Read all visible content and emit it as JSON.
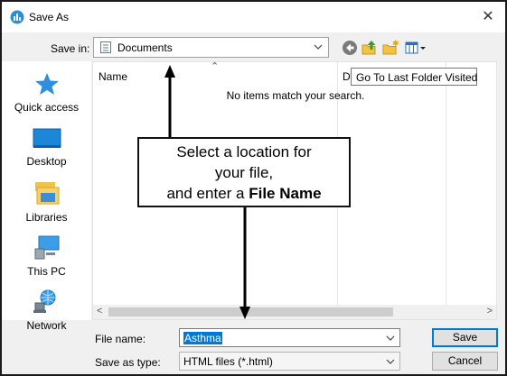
{
  "window": {
    "title": "Save As"
  },
  "toolbar": {
    "save_in_label": "Save in:",
    "save_in_value": "Documents",
    "tooltip": "Go To Last Folder Visited"
  },
  "places": [
    {
      "label": "Quick access",
      "icon": "star-icon"
    },
    {
      "label": "Desktop",
      "icon": "desktop-icon"
    },
    {
      "label": "Libraries",
      "icon": "libraries-icon"
    },
    {
      "label": "This PC",
      "icon": "computer-icon"
    },
    {
      "label": "Network",
      "icon": "network-icon"
    }
  ],
  "filelist": {
    "columns": [
      "Name",
      "D"
    ],
    "empty_message": "No items match your search."
  },
  "callout": {
    "line1": "Select a location for",
    "line2": "your file,",
    "line3_prefix": "and enter a ",
    "line3_bold": "File Name"
  },
  "form": {
    "file_name_label": "File name:",
    "file_name_value": "Asthma",
    "save_type_label": "Save as type:",
    "save_type_value": "HTML files (*.html)"
  },
  "buttons": {
    "save": "Save",
    "cancel": "Cancel"
  },
  "colors": {
    "accent": "#0078d7",
    "arrow": "#000000"
  }
}
